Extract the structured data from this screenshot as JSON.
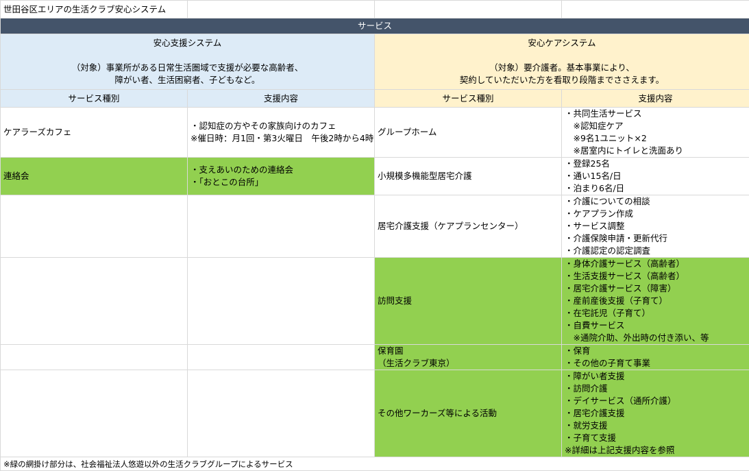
{
  "title": "世田谷区エリアの生活クラブ安心システム",
  "banner": "サービス",
  "left": {
    "heading": "安心支援システム",
    "desc": [
      "（対象）事業所がある日常生活圏域で支援が必要な高齢者、",
      "障がい者、生活困窮者、子どもなど。"
    ],
    "col_type": "サービス種別",
    "col_content": "支援内容",
    "rows": [
      {
        "type": "ケアラーズカフェ",
        "content": [
          "・認知症の方やその家族向けのカフェ",
          "※催日時：月1回・第3火曜日　午後2時から4時"
        ]
      },
      {
        "type": "連絡会",
        "content": [
          "・支えあいのための連絡会",
          "・「おとこの台所」"
        ]
      }
    ]
  },
  "right": {
    "heading": "安心ケアシステム",
    "desc": [
      "（対象）要介護者。基本事業により、",
      "契約していただいた方を看取り段階までささえます。"
    ],
    "col_type": "サービス種別",
    "col_content": "支援内容",
    "rows": [
      {
        "type": "グループホーム",
        "content": [
          "・共同生活サービス",
          "　※認知症ケア",
          "　※9名1ユニット×2",
          "　※居室内にトイレと洗面あり"
        ]
      },
      {
        "type": "小規模多機能型居宅介護",
        "content": [
          "・登録25名",
          "・通い15名/日",
          "・泊まり6名/日"
        ]
      },
      {
        "type": "居宅介護支援（ケアプランセンター）",
        "content": [
          "・介護についての相談",
          "・ケアプラン作成",
          "・サービス調整",
          "・介護保険申請・更新代行",
          "・介護認定の認定調査"
        ]
      },
      {
        "type": "訪問支援",
        "content": [
          "・身体介護サービス（高齢者）",
          "・生活支援サービス（高齢者）",
          "・居宅介護サービス（障害）",
          "・産前産後支援（子育て）",
          "・在宅託児（子育て）",
          "・自費サービス",
          "　※通院介助、外出時の付き添い、等"
        ]
      },
      {
        "type": "保育園\n（生活クラブ東京）",
        "content": [
          "・保育",
          "・その他の子育て事業"
        ]
      },
      {
        "type": "その他ワーカーズ等による活動",
        "content": [
          "・障がい者支援",
          "・訪問介護",
          "・デイサービス（通所介護）",
          "・居宅介護支援",
          "・就労支援",
          "・子育て支援",
          "※詳細は上記支援内容を参照"
        ]
      }
    ]
  },
  "footnote": "※緑の網掛け部分は、社会福祉法人悠遊以外の生活クラブグループによるサービス"
}
